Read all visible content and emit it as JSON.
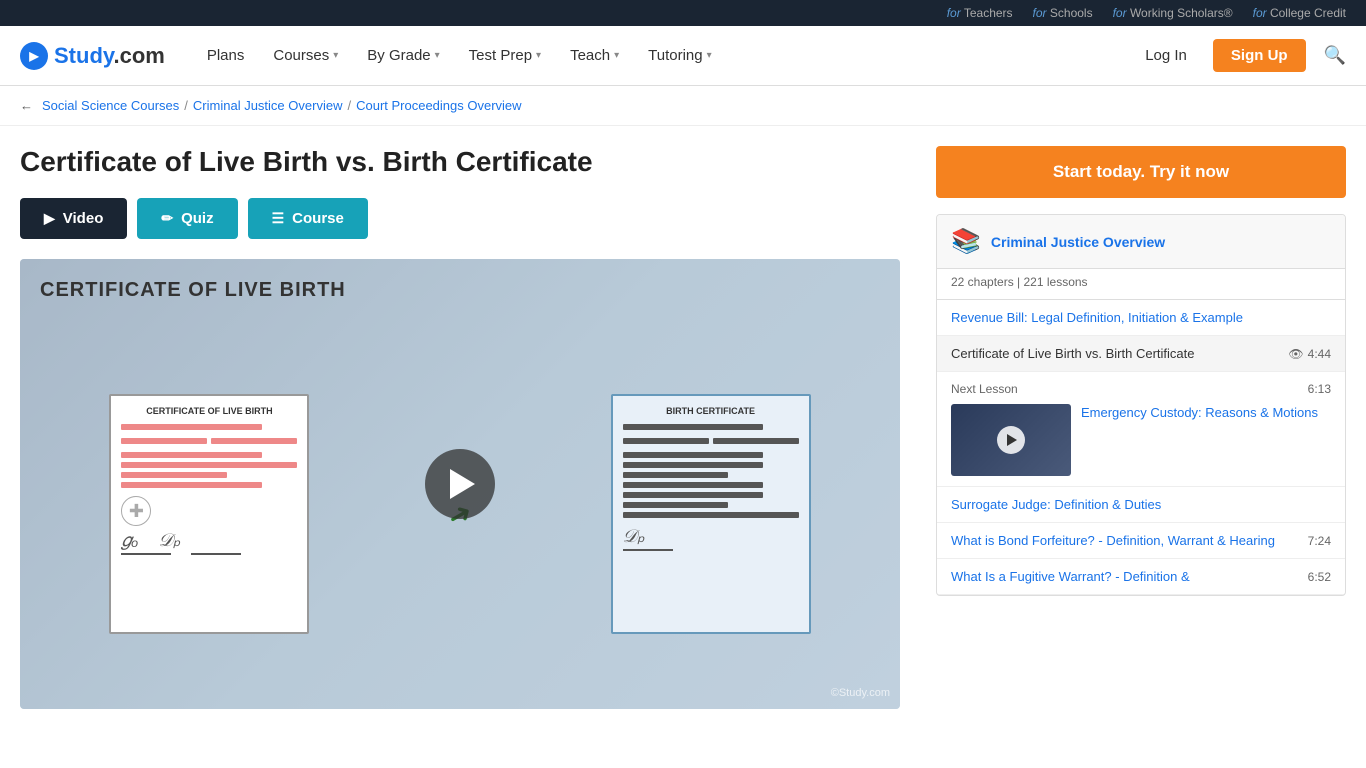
{
  "topBar": {
    "links": [
      {
        "label": "Teachers",
        "prefix": "for"
      },
      {
        "label": "Schools",
        "prefix": "for"
      },
      {
        "label": "Working Scholars®",
        "prefix": "for"
      },
      {
        "label": "College Credit",
        "prefix": "for"
      }
    ]
  },
  "nav": {
    "logoText": "Study.com",
    "links": [
      {
        "label": "Plans",
        "hasDropdown": false
      },
      {
        "label": "Courses",
        "hasDropdown": true
      },
      {
        "label": "By Grade",
        "hasDropdown": true
      },
      {
        "label": "Test Prep",
        "hasDropdown": true
      },
      {
        "label": "Teach",
        "hasDropdown": true
      },
      {
        "label": "Tutoring",
        "hasDropdown": true
      }
    ],
    "loginLabel": "Log In",
    "signupLabel": "Sign Up"
  },
  "breadcrumb": {
    "backLabel": "Social Science Courses",
    "crumb2": "Criminal Justice Overview",
    "crumb3": "Court Proceedings Overview",
    "currentPage": ""
  },
  "page": {
    "title": "Certificate of Live Birth vs. Birth Certificate"
  },
  "tabs": [
    {
      "label": "Video",
      "icon": "▶",
      "active": true
    },
    {
      "label": "Quiz",
      "icon": "✏",
      "active": false
    },
    {
      "label": "Course",
      "icon": "☰",
      "active": false
    }
  ],
  "video": {
    "title": "CERTIFICATE OF LIVE BIRTH",
    "doc1Title": "CERTIFICATE OF LIVE BIRTH",
    "doc2Title": "BIRTH CERTIFICATE",
    "watermark": "©Study.com"
  },
  "sidebar": {
    "ctaLabel": "Start today. Try it now",
    "courseIcon": "📚",
    "courseTitle": "Criminal Justice Overview",
    "courseMeta": "22 chapters | 221 lessons",
    "lessons": [
      {
        "type": "link",
        "label": "Revenue Bill: Legal Definition, Initiation & Example",
        "duration": null
      },
      {
        "type": "active",
        "label": "Certificate of Live Birth vs. Birth Certificate",
        "duration": "4:44"
      },
      {
        "type": "next",
        "nextLabel": "Next Lesson",
        "duration": "6:13",
        "label": "Emergency Custody: Reasons & Motions"
      }
    ],
    "otherLessons": [
      {
        "label": "Surrogate Judge: Definition & Duties",
        "duration": null
      },
      {
        "label": "What is Bond Forfeiture? - Definition, Warrant & Hearing",
        "duration": "7:24"
      },
      {
        "label": "What Is a Fugitive Warrant? - Definition &",
        "duration": "6:52"
      }
    ]
  }
}
